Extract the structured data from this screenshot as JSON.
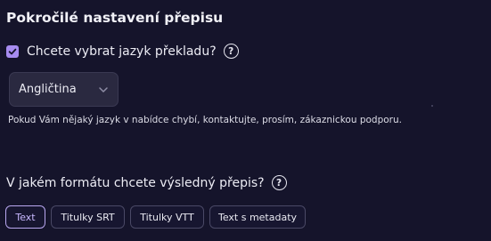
{
  "panel": {
    "title": "Pokročilé nastavení přepisu"
  },
  "translation": {
    "checkbox_checked": true,
    "question": "Chcete vybrat jazyk překladu?",
    "help_icon": "?"
  },
  "language_select": {
    "value": "Angličtina",
    "chevron_icon": "chevron-down-icon"
  },
  "info": {
    "text": "Pokud Vám nějaký jazyk v nabídce chybí, kontaktujte, prosím, zákaznickou podporu."
  },
  "format": {
    "question": "V jakém formátu chcete výsledný přepis?",
    "help_icon": "?",
    "options": [
      "Text",
      "Titulky SRT",
      "Titulky VTT",
      "Text s metadaty"
    ],
    "selected": "Text"
  },
  "colors": {
    "background": "#15142b",
    "accent": "#a78cf0",
    "selected_border": "#b9a7f0"
  }
}
